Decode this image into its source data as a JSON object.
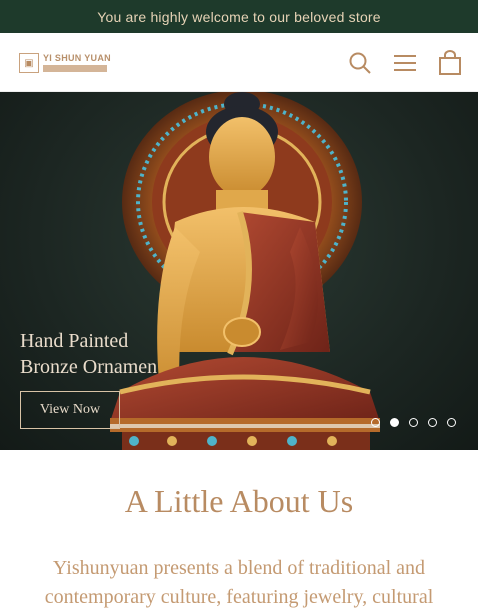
{
  "announcement": {
    "text": "You are highly welcome to our beloved store"
  },
  "header": {
    "logo": {
      "text": "YI SHUN YUAN"
    },
    "icons": [
      "search-icon",
      "menu-icon",
      "cart-icon"
    ]
  },
  "hero": {
    "title_line1": "Hand Painted",
    "title_line2": "Bronze Ornamen",
    "button_label": "View Now",
    "slide_count": 5,
    "active_slide": 2
  },
  "about": {
    "title": "A Little About Us",
    "body_line1": "Yishunyuan presents a blend of traditional and",
    "body_line2": "contemporary culture, featuring jewelry, cultural"
  },
  "colors": {
    "announcement_bg": "#1e3a2b",
    "announcement_text": "#e6d3b6",
    "accent": "#b88b62",
    "hero_bg": "#1c2622"
  }
}
